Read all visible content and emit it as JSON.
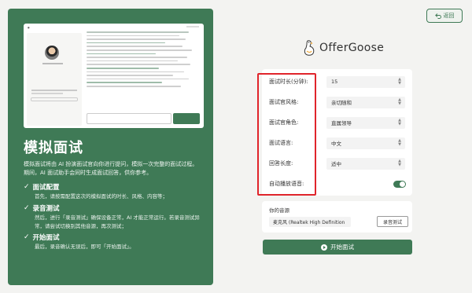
{
  "left_panel": {
    "title": "模拟面试",
    "intro": "模拟面试将由 AI 扮演面试官向你进行提问，模拟一次完整的面试过程。期间，AI 面试助手会同时生成面试回答，供你参考。",
    "steps": [
      {
        "title": "面试配置",
        "desc": "首先，请按需配置这次的模拟面试的时长、风格、内容等；"
      },
      {
        "title": "录音测试",
        "desc": "然后，进行「录音测试」确保设备正常，AI 才能正常运行。若录音测试异常，请尝试切换别其他音源，再次测试；"
      },
      {
        "title": "开始面试",
        "desc": "最后，录音确认无误后，即可「开始面试」。"
      }
    ]
  },
  "header": {
    "back_label": "返回",
    "brand": "OfferGoose"
  },
  "settings": [
    {
      "label": "面试时长(分钟):",
      "value": "15",
      "type": "select"
    },
    {
      "label": "面试官风格:",
      "value": "亲切随和",
      "type": "select"
    },
    {
      "label": "面试官角色:",
      "value": "直属领导",
      "type": "select"
    },
    {
      "label": "面试语言:",
      "value": "中文",
      "type": "select"
    },
    {
      "label": "回答长度:",
      "value": "适中",
      "type": "select"
    },
    {
      "label": "自动播放语音:",
      "value": "on",
      "type": "toggle"
    }
  ],
  "audio": {
    "label": "你的音源",
    "device": "麦克风 (Realtek High Definition",
    "test_button": "录音测试"
  },
  "start_button": "开始面试",
  "colors": {
    "accent": "#3f7a56",
    "highlight": "#e0242b"
  }
}
